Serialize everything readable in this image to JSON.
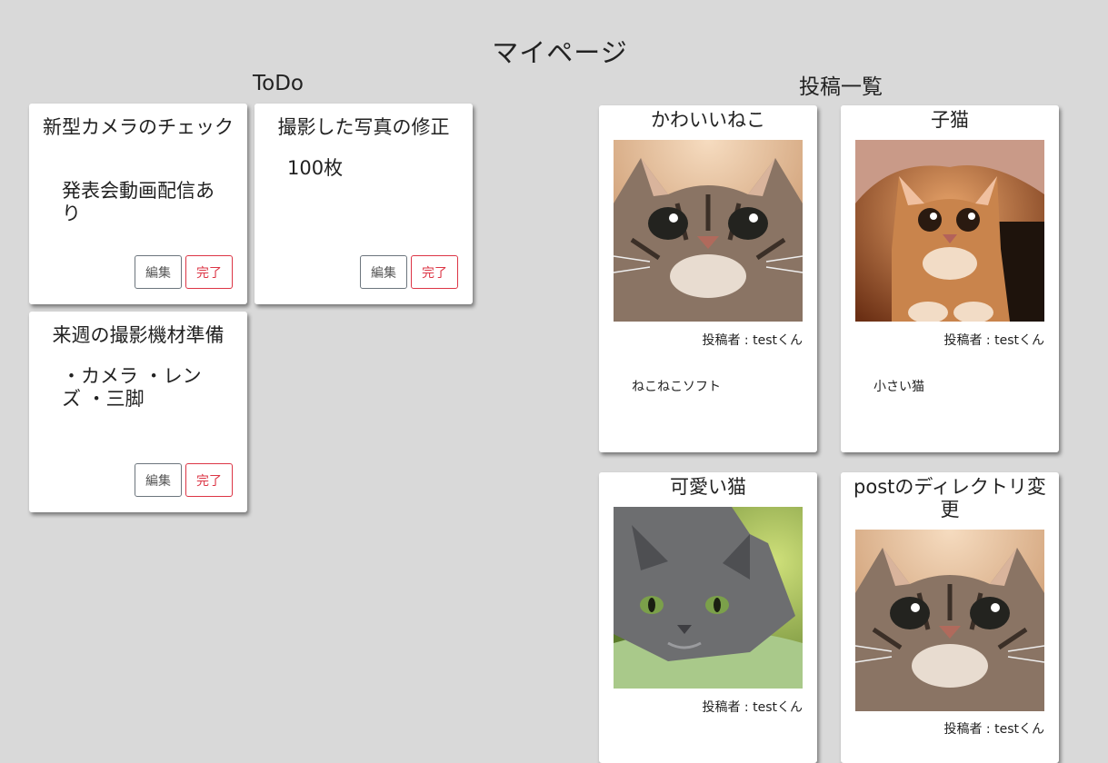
{
  "page": {
    "title": "マイページ"
  },
  "todo": {
    "heading": "ToDo",
    "items": [
      {
        "title": "新型カメラのチェック",
        "body": "発表会動画配信あり",
        "edit_label": "編集",
        "done_label": "完了"
      },
      {
        "title": "撮影した写真の修正",
        "body": "100枚",
        "edit_label": "編集",
        "done_label": "完了"
      },
      {
        "title": "来週の撮影機材準備",
        "body": "・カメラ ・レンズ ・三脚",
        "edit_label": "編集",
        "done_label": "完了"
      }
    ]
  },
  "posts": {
    "heading": "投稿一覧",
    "items": [
      {
        "title": "かわいいねこ",
        "author": "投稿者 : testくん",
        "text": "ねこねこソフト",
        "image": "tabby-cat-photo"
      },
      {
        "title": "子猫",
        "author": "投稿者 : testくん",
        "text": "小さい猫",
        "image": "kitten-photo"
      },
      {
        "title": "可愛い猫",
        "author": "投稿者 : testくん",
        "text": "",
        "image": "gray-cat-photo"
      },
      {
        "title": "postのディレクトリ変更",
        "author": "投稿者 : testくん",
        "text": "",
        "image": "tabby-cat-photo"
      }
    ]
  },
  "colors": {
    "background": "#d9d9d9",
    "card": "#ffffff",
    "done_button": "#dc3545",
    "edit_button": "#6c757d"
  }
}
